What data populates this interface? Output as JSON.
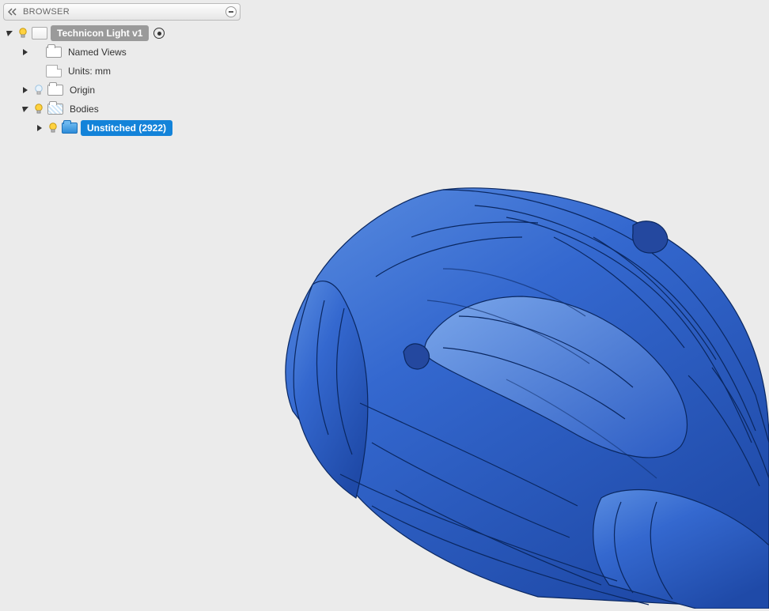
{
  "browser": {
    "title": "BROWSER",
    "root": {
      "label": "Technicon Light v1"
    },
    "items": {
      "named_views": "Named Views",
      "units": "Units: mm",
      "origin": "Origin",
      "bodies": "Bodies",
      "unstitched": "Unstitched (2922)"
    }
  },
  "model": {
    "selected_body": "Unstitched",
    "body_face_count": 2922,
    "selection_color": "#2b5fc6",
    "edge_color": "#0a2760"
  }
}
